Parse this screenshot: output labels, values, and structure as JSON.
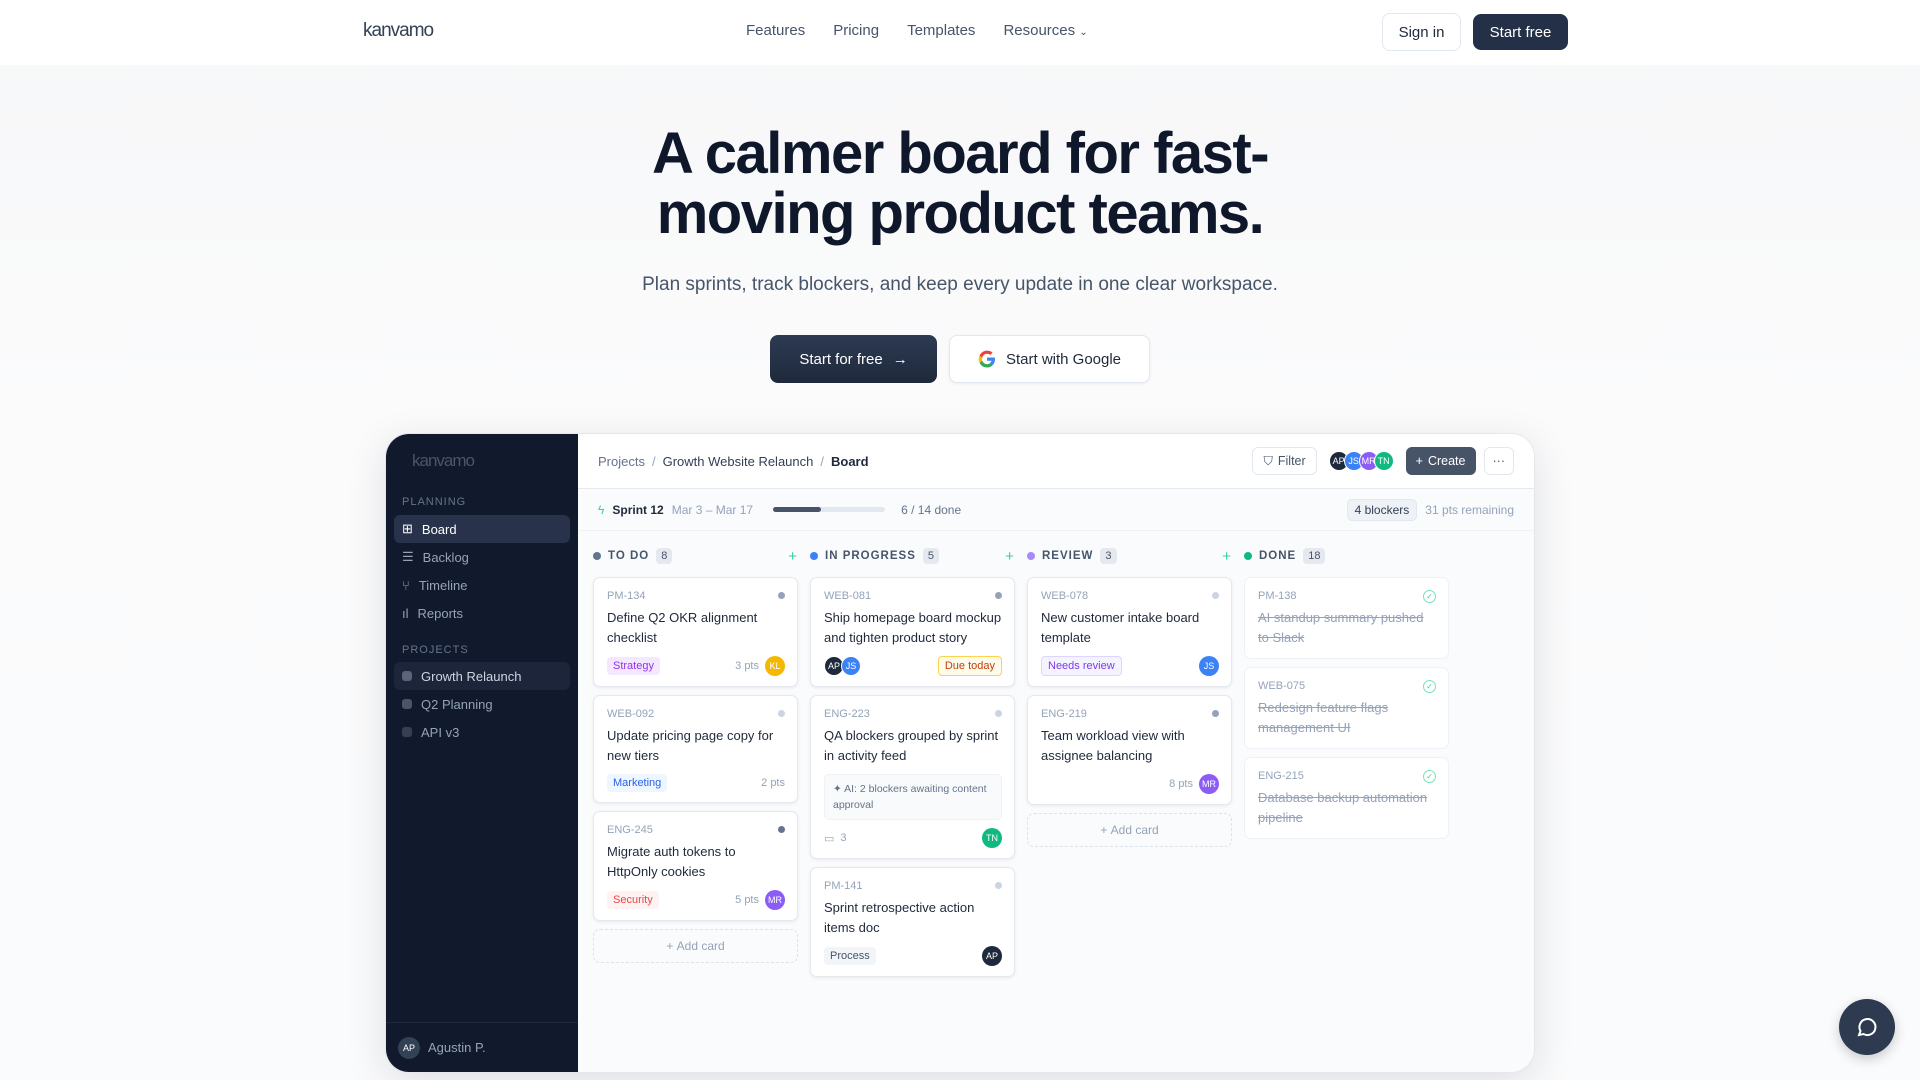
{
  "nav": {
    "logo": "kanvamo",
    "links": [
      "Features",
      "Pricing",
      "Templates",
      "Resources"
    ],
    "sign_in": "Sign in",
    "start_free": "Start free"
  },
  "hero": {
    "title_line1": "A calmer board for fast-",
    "title_line2": "moving product teams.",
    "subtitle": "Plan sprints, track blockers, and keep every update in one clear workspace.",
    "cta_primary": "Start for free",
    "cta_google": "Start with Google"
  },
  "app": {
    "sidebar": {
      "logo": "kanvamo",
      "planning_label": "PLANNING",
      "planning": [
        "Board",
        "Backlog",
        "Timeline",
        "Reports"
      ],
      "projects_label": "PROJECTS",
      "projects": [
        "Growth Relaunch",
        "Q2 Planning",
        "API v3"
      ],
      "user_initials": "AP",
      "user_name": "Agustin P."
    },
    "breadcrumb": [
      "Projects",
      "Growth Website Relaunch",
      "Board"
    ],
    "filter": "Filter",
    "create": "Create",
    "more": "···",
    "members": [
      {
        "i": "AP",
        "c": "#1e293b"
      },
      {
        "i": "JS",
        "c": "#3b82f6"
      },
      {
        "i": "MR",
        "c": "#8b5cf6"
      },
      {
        "i": "TN",
        "c": "#10b981"
      }
    ],
    "sprint": {
      "name": "Sprint 12",
      "dates": "Mar 3 – Mar 17",
      "progress": 0.43,
      "done": "6 / 14 done",
      "blockers": "4 blockers",
      "remaining": "31 pts remaining"
    },
    "add_card": "Add card",
    "columns": [
      {
        "title": "TO DO",
        "count": "8",
        "color": "#64748b",
        "cards": [
          {
            "id": "PM-134",
            "title": "Define Q2 OKR alignment checklist",
            "tag": "Strategy",
            "pts": "3 pts",
            "avatar": "KL"
          },
          {
            "id": "WEB-092",
            "title": "Update pricing page copy for new tiers",
            "tag": "Marketing",
            "pts": "2 pts"
          },
          {
            "id": "ENG-245",
            "title": "Migrate auth tokens to HttpOnly cookies",
            "tag": "Security",
            "pts": "5 pts",
            "avatar": "MR"
          }
        ]
      },
      {
        "title": "IN PROGRESS",
        "count": "5",
        "color": "#3b82f6",
        "cards": [
          {
            "id": "WEB-081",
            "title": "Ship homepage board mockup and tighten product story",
            "avatars": [
              "AP",
              "JS"
            ],
            "badge": "Due today"
          },
          {
            "id": "ENG-223",
            "title": "QA blockers grouped by sprint in activity feed",
            "ai": "✦ AI: 2 blockers awaiting content approval",
            "comments": "3",
            "avatar": "TN"
          },
          {
            "id": "PM-141",
            "title": "Sprint retrospective action items doc",
            "tag": "Process",
            "avatar": "AP"
          }
        ]
      },
      {
        "title": "REVIEW",
        "count": "3",
        "color": "#a78bfa",
        "cards": [
          {
            "id": "WEB-078",
            "title": "New customer intake board template",
            "tag": "Needs review",
            "avatar": "JS"
          },
          {
            "id": "ENG-219",
            "title": "Team workload view with assignee balancing",
            "pts": "8 pts",
            "avatar": "MR"
          }
        ]
      },
      {
        "title": "DONE",
        "count": "18",
        "color": "#10b981",
        "cards": [
          {
            "id": "PM-138",
            "title": "AI standup summary pushed to Slack"
          },
          {
            "id": "WEB-075",
            "title": "Redesign feature flags management UI"
          },
          {
            "id": "ENG-215",
            "title": "Database backup automation pipeline"
          }
        ]
      }
    ]
  }
}
